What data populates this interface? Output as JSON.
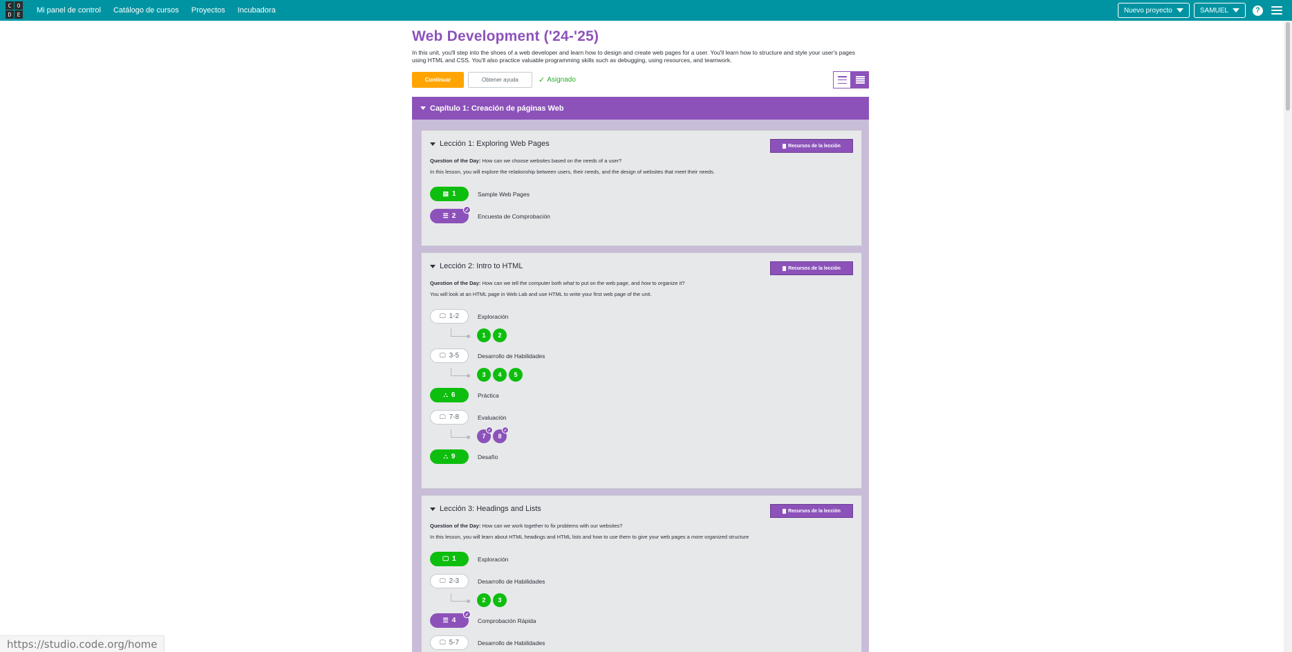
{
  "logo_letters": [
    "C",
    "O",
    "D",
    "E"
  ],
  "header": {
    "nav": [
      "Mi panel de control",
      "Catálogo de cursos",
      "Proyectos",
      "Incubadora"
    ],
    "new_project": "Nuevo proyecto",
    "user": "SAMUEL",
    "help": "?"
  },
  "unit": {
    "title": "Web Development ('24-'25)",
    "description": "In this unit, you'll step into the shoes of a web developer and learn how to design and create web pages for a user. You'll learn how to structure and style your user's pages using HTML and CSS. You'll also practice valuable programming skills such as debugging, using resources, and teamwork.",
    "continue": "Continuar",
    "get_help": "Obtener ayuda",
    "assigned": "Asignado"
  },
  "chapter": {
    "title": "Capítulo 1: Creación de páginas Web"
  },
  "resources_label": "Recursos de la lección",
  "qotd_label": "Question of the Day:",
  "lessons": [
    {
      "title": "Lección 1: Exploring Web Pages",
      "question": "How can we choose websites based on the needs of a user?",
      "description": "In this lesson, you will explore the relationship between users, their needs, and the design of websites that meet their needs.",
      "levels": [
        {
          "num": "1",
          "label": "Sample Web Pages",
          "style": "green",
          "icon": "document-icon",
          "icon_glyph": "▤"
        },
        {
          "num": "2",
          "label": "Encuesta de Comprobación",
          "style": "purple",
          "icon": "list-icon",
          "icon_glyph": "☰",
          "checked": true
        }
      ]
    },
    {
      "title": "Lección 2: Intro to HTML",
      "question_parts": [
        "How can we tell the computer both ",
        "what",
        " to put on the web page, and ",
        "how",
        " to organize it?"
      ],
      "description": "You will look at an HTML page in Web Lab and use HTML to write your first web page of the unit.",
      "levels": [
        {
          "num": "1-2",
          "label": "Exploración",
          "style": "outline",
          "icon": "monitor-icon",
          "icon_glyph": "🖵",
          "bubbles": [
            "1",
            "2"
          ],
          "bubble_style": "green"
        },
        {
          "num": "3-5",
          "label": "Desarrollo de Habilidades",
          "style": "outline",
          "icon": "monitor-icon",
          "icon_glyph": "🖵",
          "bubbles": [
            "3",
            "4",
            "5"
          ],
          "bubble_style": "green"
        },
        {
          "num": "6",
          "label": "Práctica",
          "style": "green",
          "icon": "network-icon",
          "icon_glyph": "⛬"
        },
        {
          "num": "7-8",
          "label": "Evaluación",
          "style": "outline",
          "icon": "monitor-icon",
          "icon_glyph": "🖵",
          "bubbles": [
            "7",
            "8"
          ],
          "bubble_style": "purple"
        },
        {
          "num": "9",
          "label": "Desafío",
          "style": "green",
          "icon": "network-icon",
          "icon_glyph": "⛬"
        }
      ]
    },
    {
      "title": "Lección 3: Headings and Lists",
      "question": "How can we work together to fix problems with our websites?",
      "description": "In this lesson, you will learn about HTML headings and HTML lists and how to use them to give your web pages a more organized structure",
      "levels": [
        {
          "num": "1",
          "label": "Exploración",
          "style": "green",
          "icon": "monitor-icon",
          "icon_glyph": "🖵"
        },
        {
          "num": "2-3",
          "label": "Desarrollo de Habilidades",
          "style": "outline",
          "icon": "monitor-icon",
          "icon_glyph": "🖵",
          "bubbles": [
            "2",
            "3"
          ],
          "bubble_style": "green"
        },
        {
          "num": "4",
          "label": "Comprobación Rápida",
          "style": "purple",
          "icon": "list-icon",
          "icon_glyph": "☰",
          "checked": true
        },
        {
          "num": "5-7",
          "label": "Desarrollo de Habilidades",
          "style": "outline",
          "icon": "monitor-icon",
          "icon_glyph": "🖵"
        }
      ]
    }
  ],
  "status_url": "https://studio.code.org/home"
}
